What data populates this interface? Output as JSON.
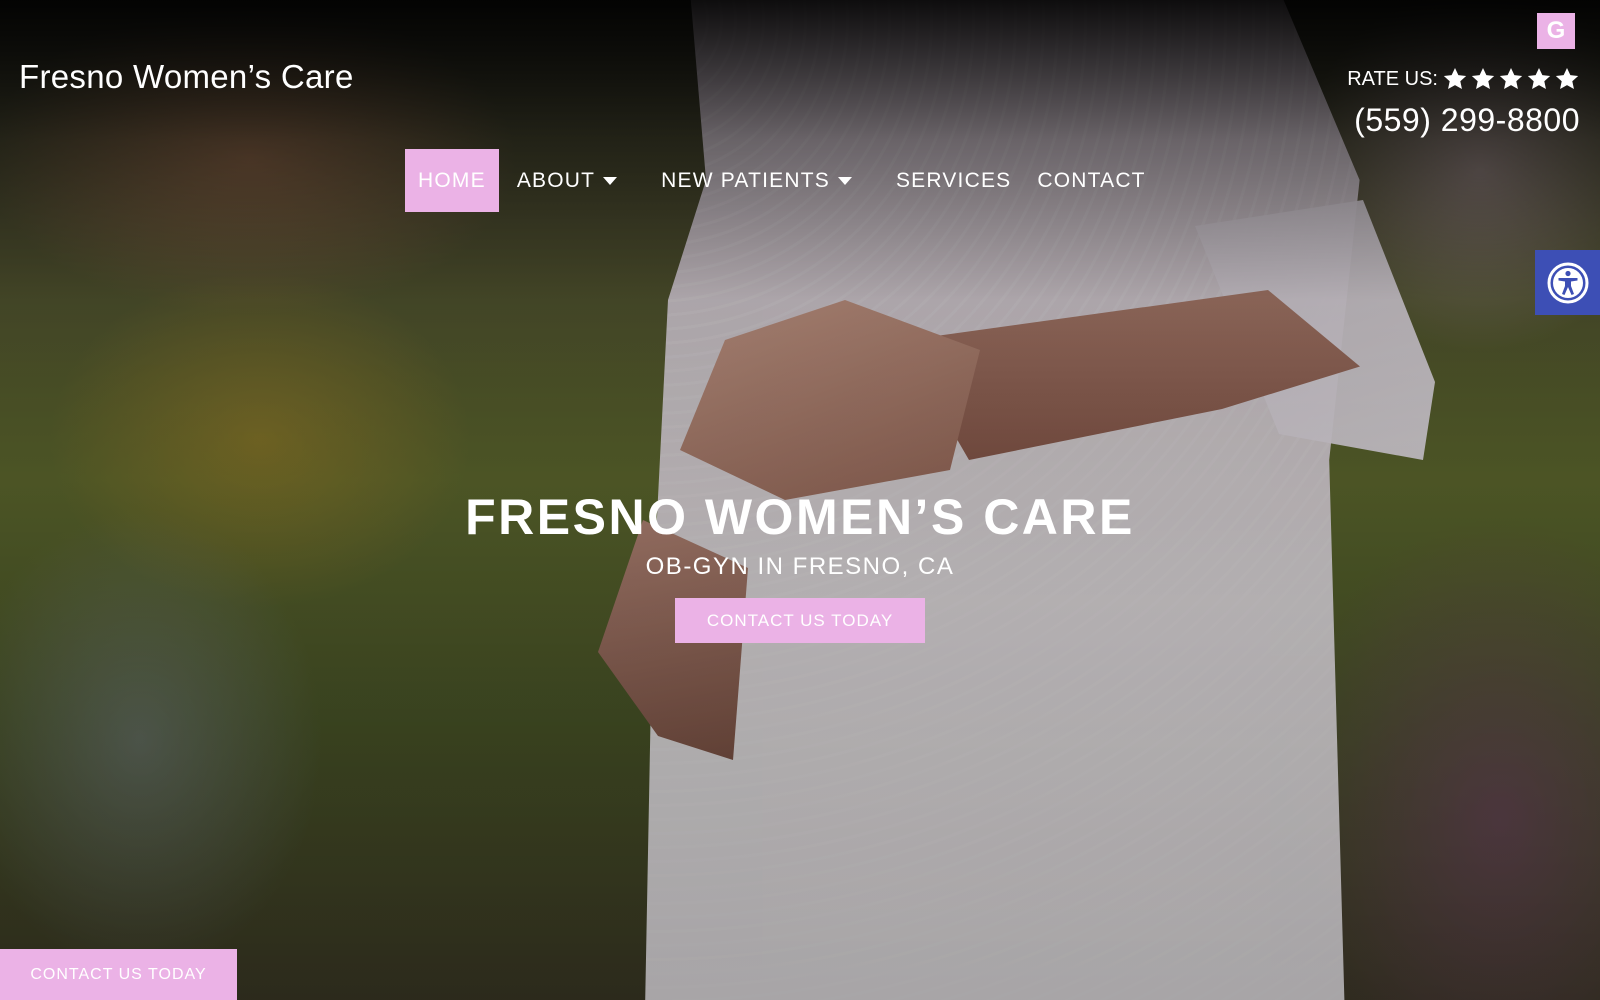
{
  "header": {
    "site_title": "Fresno Women’s Care",
    "google_badge": "G",
    "rate_label": "RATE US:",
    "star_count": 5,
    "phone": "(559) 299-8800"
  },
  "nav": {
    "items": [
      {
        "label": "HOME",
        "active": true,
        "dropdown": false
      },
      {
        "label": "ABOUT",
        "active": false,
        "dropdown": true
      },
      {
        "label": "NEW PATIENTS",
        "active": false,
        "dropdown": true
      },
      {
        "label": "SERVICES",
        "active": false,
        "dropdown": false
      },
      {
        "label": "CONTACT",
        "active": false,
        "dropdown": false
      }
    ]
  },
  "hero": {
    "title": "FRESNO WOMEN’S CARE",
    "subtitle": "OB-GYN IN FRESNO, CA",
    "cta_label": "CONTACT US TODAY"
  },
  "sticky_cta": {
    "label": "CONTACT US TODAY"
  },
  "icons": {
    "google": "google-icon",
    "star": "star-icon",
    "caret": "chevron-down-icon",
    "accessibility": "accessibility-icon"
  },
  "colors": {
    "accent_pink": "#ebb2e6",
    "accessibility_blue": "#3d4fb5",
    "text": "#ffffff"
  }
}
